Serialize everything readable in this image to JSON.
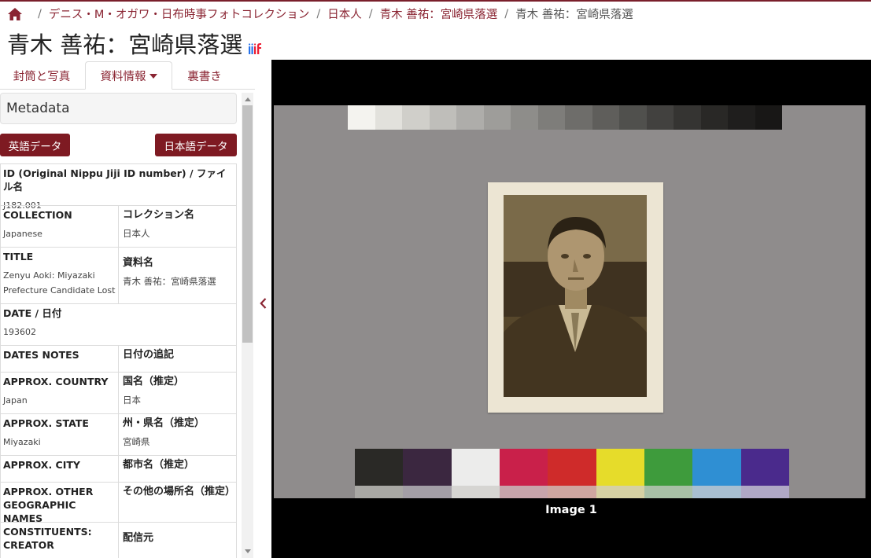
{
  "breadcrumb": {
    "items": [
      "デニス・M・オガワ・日布時事フォトコレクション",
      "日本人",
      "青木 善祐：宮崎県落選",
      "青木 善祐：宮崎県落選"
    ],
    "separator": "/"
  },
  "page": {
    "title": "青木 善祐：宮崎県落選"
  },
  "tabs": [
    {
      "label": "封筒と写真"
    },
    {
      "label": "資料情報"
    },
    {
      "label": "裏書き"
    }
  ],
  "metadata": {
    "header": "Metadata",
    "english_button": "英語データ",
    "japanese_button": "日本語データ",
    "rows": [
      {
        "label_en": "ID (Original Nippu Jiji ID number) / ファイル名",
        "value_en": "J182.001",
        "label_jp": "",
        "value_jp": ""
      },
      {
        "label_en": "COLLECTION",
        "value_en": "Japanese",
        "label_jp": "コレクション名",
        "value_jp": "日本人"
      },
      {
        "label_en": "TITLE",
        "value_en": "Zenyu Aoki: Miyazaki Prefecture Candidate Lost",
        "label_jp": "資料名",
        "value_jp": "青木 善祐：宮崎県落選"
      },
      {
        "label_en": "DATE / 日付",
        "value_en": "193602",
        "label_jp": "",
        "value_jp": ""
      },
      {
        "label_en": "DATES NOTES",
        "value_en": "",
        "label_jp": "日付の追記",
        "value_jp": ""
      },
      {
        "label_en": "APPROX. COUNTRY",
        "value_en": "Japan",
        "label_jp": "国名（推定）",
        "value_jp": "日本"
      },
      {
        "label_en": "APPROX. STATE",
        "value_en": "Miyazaki",
        "label_jp": "州・県名（推定）",
        "value_jp": "宮崎県"
      },
      {
        "label_en": "APPROX. CITY",
        "value_en": "",
        "label_jp": "都市名（推定）",
        "value_jp": ""
      },
      {
        "label_en": "APPROX. OTHER GEOGRAPHIC NAMES",
        "value_en": "",
        "label_jp": "その他の場所名（推定）",
        "value_jp": ""
      },
      {
        "label_en": "CONSTITUENTS: CREATOR",
        "value_en": "",
        "label_jp": "配信元",
        "value_jp": ""
      }
    ]
  },
  "viewer": {
    "image_label": "Image 1"
  },
  "colors": {
    "brand": "#7e1a22",
    "link": "#8a2432",
    "viewer_bg": "#000000"
  },
  "icons": {
    "home": "home-icon",
    "iiif": "iiif-logo",
    "collapse": "chevron-left-icon"
  }
}
